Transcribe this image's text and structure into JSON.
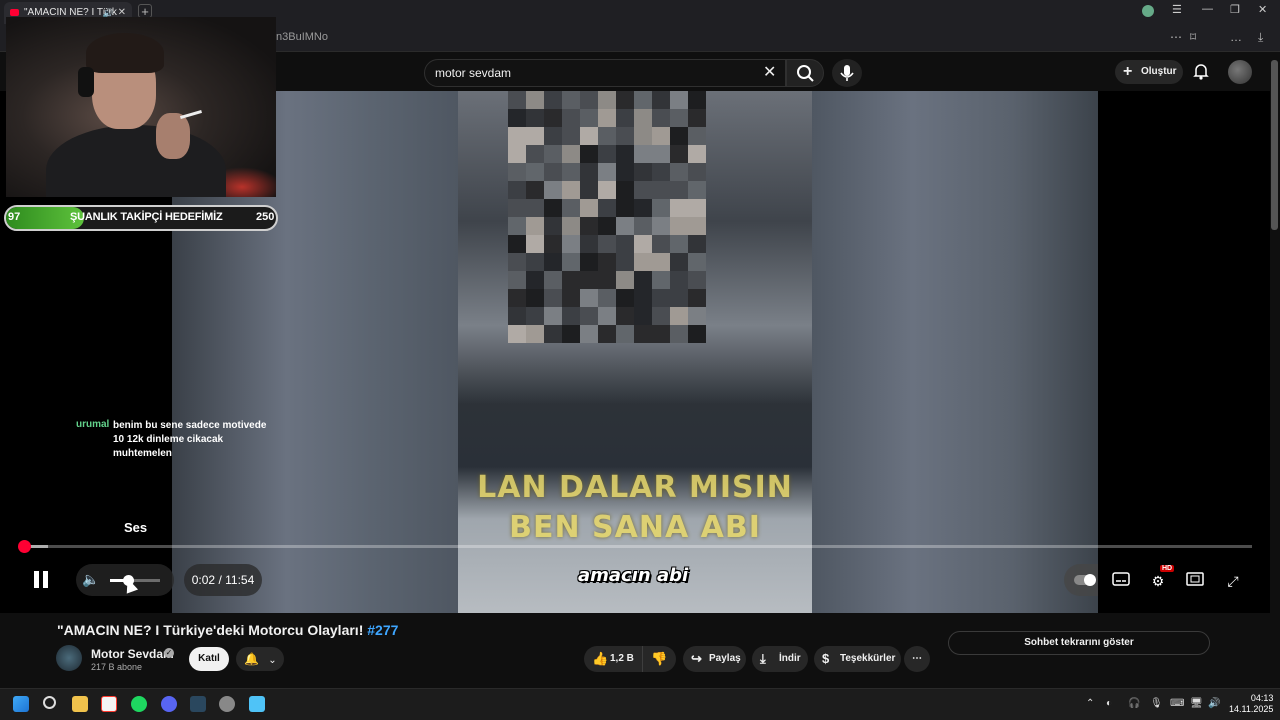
{
  "browser": {
    "tab_title": "\"AMACIN NE? I Türk",
    "url_fragment": "n3BuIMNo"
  },
  "youtube": {
    "search_value": "motor sevdam",
    "create_label": "Oluştur"
  },
  "overlay": {
    "goal_start": "97",
    "goal_title": "ŞUANLIK TAKİPÇİ HEDEFİMİZ",
    "goal_end": "250",
    "goal_fraction": 0.29,
    "chat_user": "urumal",
    "chat_message": "benim bu sene sadece motivede 10 12k dinleme cikacak muhtemelen"
  },
  "video": {
    "burned_text": "LAN DALAR MISIN BEN SANA ABI",
    "caption": "amacın abi",
    "tooltip": "Ses",
    "time": "0:02 / 11:54",
    "progress_fraction": 0.003,
    "buffer_fraction": 0.023,
    "volume_fraction": 0.35,
    "hd_badge": "HD"
  },
  "details": {
    "title_text": "\"AMACIN NE? I Türkiye'deki Motorcu Olayları! ",
    "title_tag": "#277",
    "channel_name": "Motor Sevdam",
    "subscribers": "217 B abone",
    "join_label": "Katıl",
    "likes": "1,2 B",
    "share_label": "Paylaş",
    "download_label": "İndir",
    "thanks_label": "Teşekkürler",
    "chat_replay_label": "Sohbet tekrarını göster"
  },
  "taskbar": {
    "time": "04:13",
    "date": "14.11.2025"
  },
  "colors": {
    "youtube_red": "#ff0033",
    "goal_green": "#5ec23c",
    "chat_user_green": "#63d38c",
    "hashtag_blue": "#3ea6ff"
  }
}
